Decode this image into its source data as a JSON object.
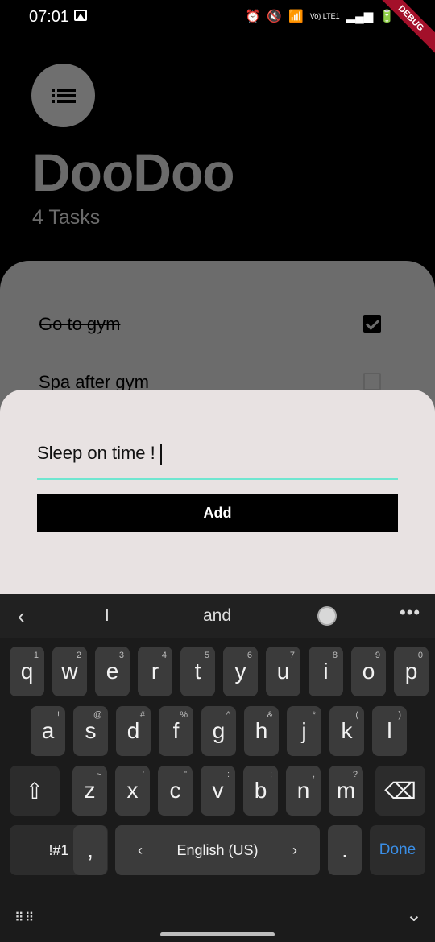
{
  "status": {
    "time": "07:01",
    "net_label": "Vo) LTE1",
    "debug": "DEBUG"
  },
  "app": {
    "title": "DooDoo",
    "task_count": "4 Tasks"
  },
  "tasks": [
    {
      "label": "Go to gym",
      "done": true
    },
    {
      "label": "Spa after gym",
      "done": false
    }
  ],
  "sheet": {
    "input_value": "Sleep on time !",
    "add_label": "Add"
  },
  "keyboard": {
    "suggestions": [
      "I",
      "and"
    ],
    "rows": [
      [
        [
          "q",
          "1"
        ],
        [
          "w",
          "2"
        ],
        [
          "e",
          "3"
        ],
        [
          "r",
          "4"
        ],
        [
          "t",
          "5"
        ],
        [
          "y",
          "6"
        ],
        [
          "u",
          "7"
        ],
        [
          "i",
          "8"
        ],
        [
          "o",
          "9"
        ],
        [
          "p",
          "0"
        ]
      ],
      [
        [
          "a",
          "!"
        ],
        [
          "s",
          "@"
        ],
        [
          "d",
          "#"
        ],
        [
          "f",
          "%"
        ],
        [
          "g",
          "^"
        ],
        [
          "h",
          "&"
        ],
        [
          "j",
          "*"
        ],
        [
          "k",
          "("
        ],
        [
          "l",
          ")"
        ]
      ],
      [
        [
          "z",
          "~"
        ],
        [
          "x",
          "'"
        ],
        [
          "c",
          "\""
        ],
        [
          "v",
          ":"
        ],
        [
          "b",
          ";"
        ],
        [
          "n",
          ","
        ],
        [
          "m",
          "?"
        ]
      ]
    ],
    "symbols_label": "!#1",
    "comma_label": ",",
    "space_label": "English (US)",
    "period_label": ".",
    "done_label": "Done"
  },
  "colors": {
    "accent_underline": "#6fe6d0",
    "done_key": "#3a8ee6"
  }
}
